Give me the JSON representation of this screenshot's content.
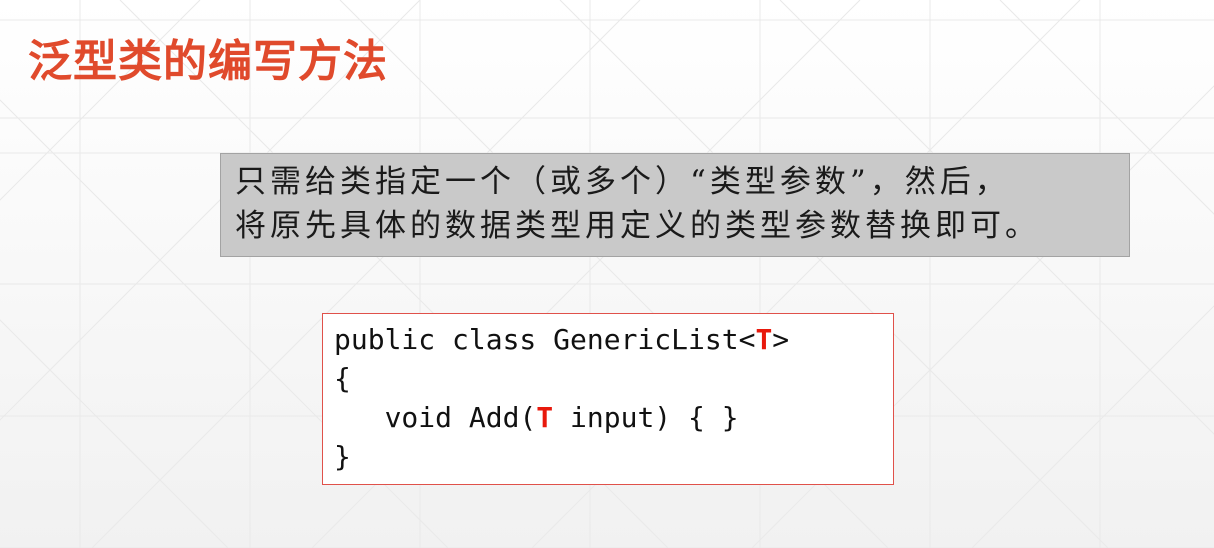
{
  "slide": {
    "title": "泛型类的编写方法",
    "title_color": "#e04a2c"
  },
  "note": {
    "line1": "只需给类指定一个（或多个）“类型参数”，然后，",
    "line2": "将原先具体的数据类型用定义的类型参数替换即可。",
    "background": "#c9c9c9"
  },
  "code": {
    "line1_pre": "public class GenericList<",
    "line1_param": "T",
    "line1_post": ">",
    "line2": "{",
    "line3_pre": "   void Add(",
    "line3_param": "T",
    "line3_post": " input) { }",
    "line4": "}",
    "param_color": "#e8190c",
    "border_color": "#e0514a"
  }
}
